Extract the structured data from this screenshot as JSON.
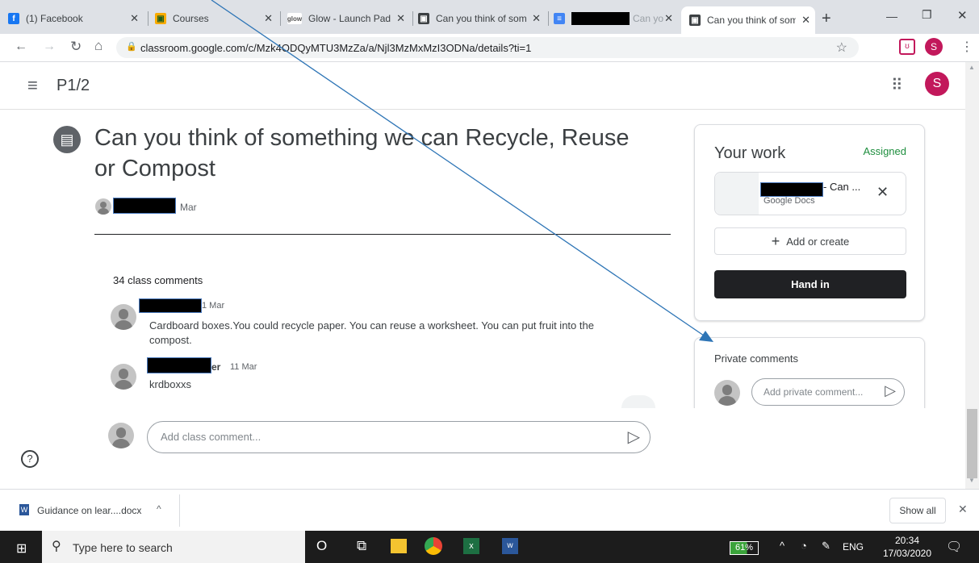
{
  "tabs": [
    {
      "title": "(1) Facebook"
    },
    {
      "title": "Courses"
    },
    {
      "title": "Glow - Launch Pad"
    },
    {
      "title": "Can you think of som"
    },
    {
      "title": "Can yo"
    },
    {
      "title": "Can you think of som"
    }
  ],
  "address": {
    "url": "classroom.google.com/c/Mzk4ODQyMTU3MzZa/a/Njl3MzMxMzI3ODNa/details?ti=1"
  },
  "app": {
    "class_name": "P1/2",
    "user_initial": "S"
  },
  "assignment": {
    "title_line1": "Can you think of something we can Recycle, Reuse",
    "title_line2": "or Compost",
    "date": "Mar"
  },
  "comments": {
    "heading": "34 class comments",
    "items": [
      {
        "date": "1 Mar",
        "text": "Cardboard boxes.You could recycle paper. You can reuse a worksheet. You can put fruit into the compost."
      },
      {
        "name_suffix": "er",
        "date": "11 Mar",
        "text": "krdboxxs"
      }
    ],
    "add_placeholder": "Add class comment..."
  },
  "your_work": {
    "title": "Your work",
    "status": "Assigned",
    "file_name": "- Can ...",
    "file_type": "Google Docs",
    "add_label": "Add or create",
    "hand_in_label": "Hand in"
  },
  "private": {
    "title": "Private comments",
    "placeholder": "Add private comment..."
  },
  "download": {
    "file": "Guidance on lear....docx",
    "show_all": "Show all"
  },
  "taskbar": {
    "search": "Type here to search",
    "battery": "61%",
    "lang": "ENG",
    "time": "20:34",
    "date": "17/03/2020"
  },
  "colors": {
    "assigned": "#1e8e3e",
    "hand_in_bg": "#202124",
    "avatar_accent": "#c2185b",
    "annotation_arrow": "#2e75b6"
  }
}
